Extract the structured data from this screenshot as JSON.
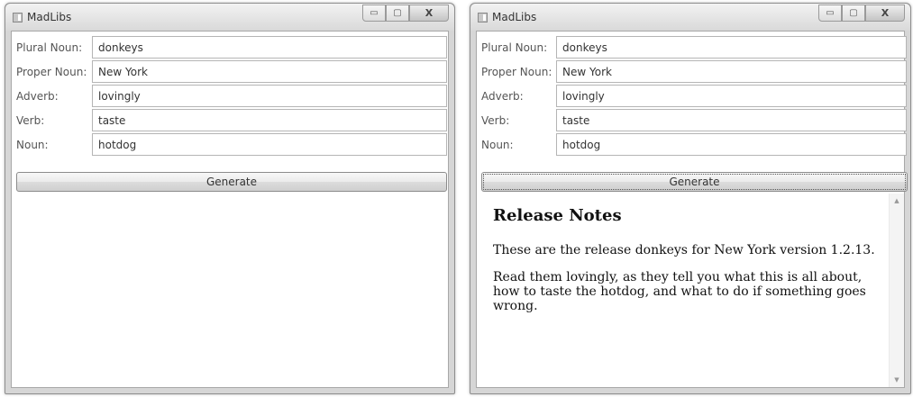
{
  "app": {
    "title": "MadLibs",
    "minimize_glyph": "▭",
    "maximize_glyph": "▢",
    "close_glyph": "X"
  },
  "form": {
    "fields": [
      {
        "label": "Plural Noun:",
        "value": "donkeys"
      },
      {
        "label": "Proper Noun:",
        "value": "New York"
      },
      {
        "label": "Adverb:",
        "value": "lovingly"
      },
      {
        "label": "Verb:",
        "value": "taste"
      },
      {
        "label": "Noun:",
        "value": "hotdog"
      }
    ],
    "generate_label": "Generate"
  },
  "release_notes": {
    "heading": "Release Notes",
    "paragraphs": [
      "These are the release donkeys for New York version 1.2.13.",
      "Read them lovingly, as they tell you what this is all about, how to taste the hotdog, and what to do if something goes wrong."
    ],
    "scroll_up_glyph": "▲",
    "scroll_down_glyph": "▼"
  },
  "colors": {
    "window_frame": "#d6d6d6",
    "client_background": "#ffffff",
    "text": "#333333"
  }
}
